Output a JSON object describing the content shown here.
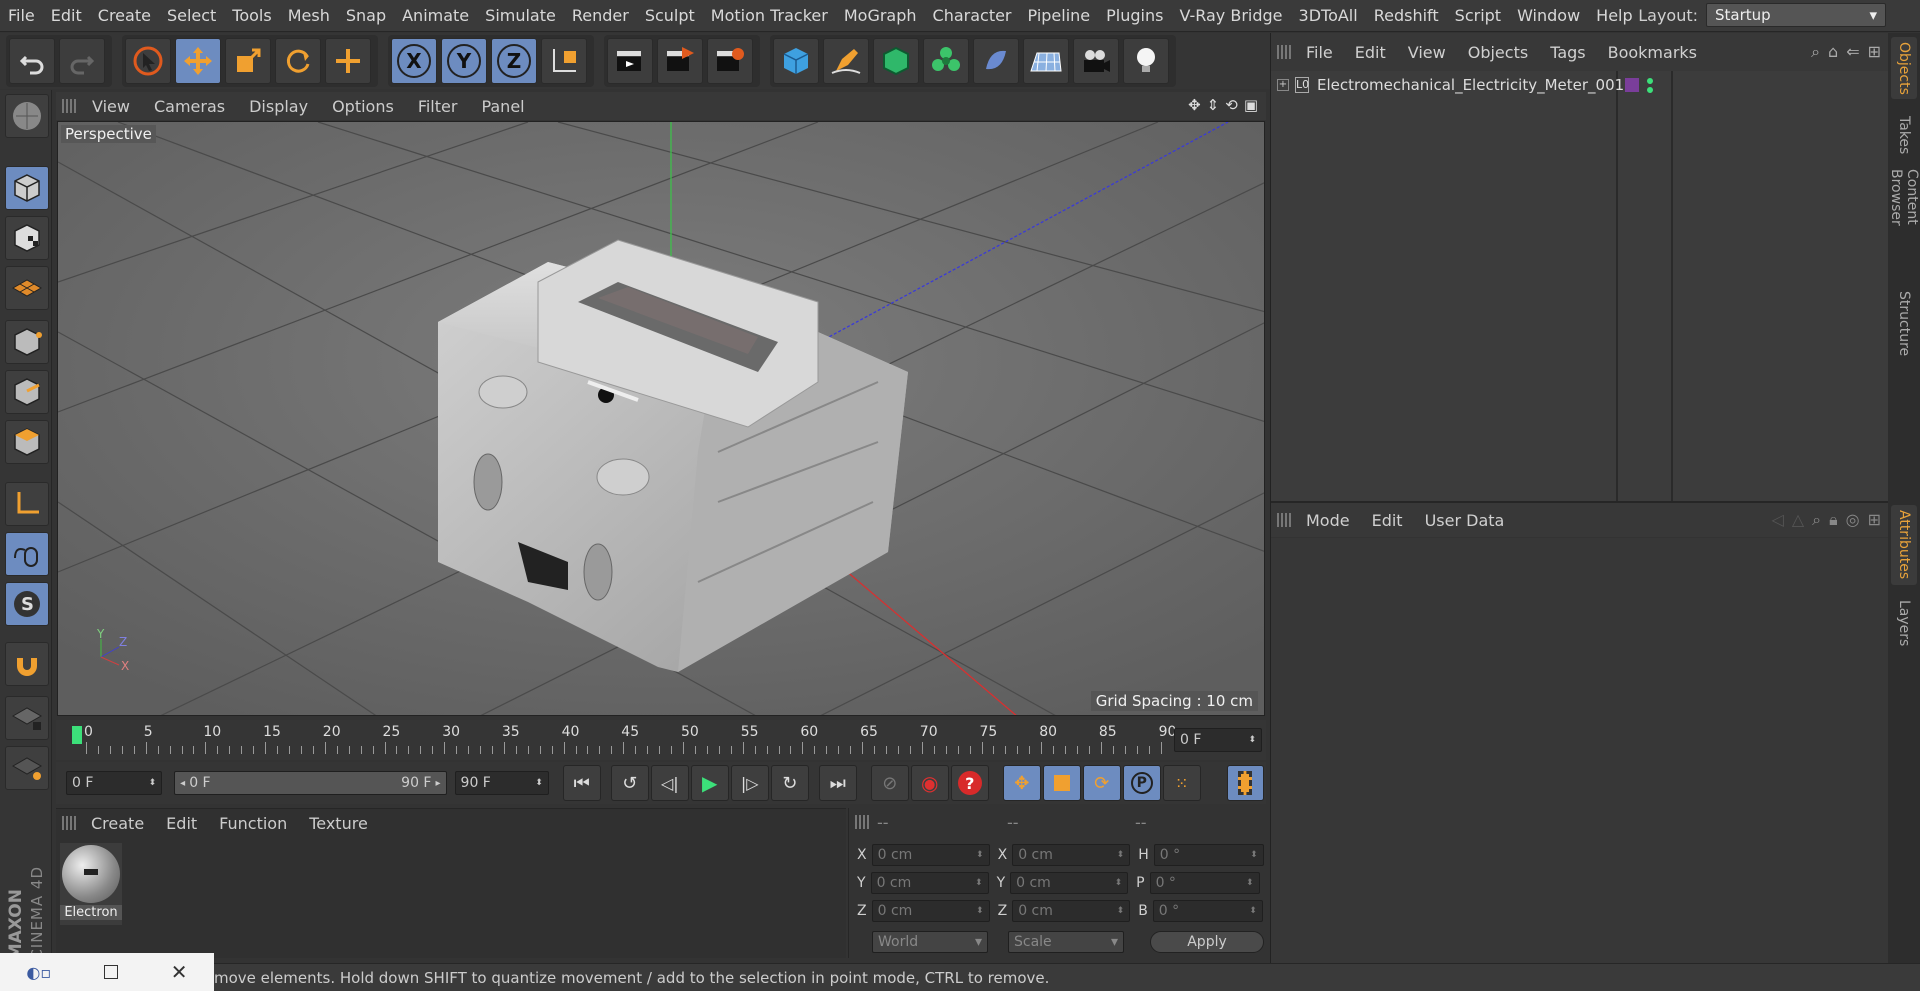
{
  "menu": [
    "File",
    "Edit",
    "Create",
    "Select",
    "Tools",
    "Mesh",
    "Snap",
    "Animate",
    "Simulate",
    "Render",
    "Sculpt",
    "Motion Tracker",
    "MoGraph",
    "Character",
    "Pipeline",
    "Plugins",
    "V-Ray Bridge",
    "3DToAll",
    "Redshift",
    "Script",
    "Window",
    "Help"
  ],
  "layout": {
    "label": "Layout:",
    "value": "Startup"
  },
  "toolbar": {
    "axis_x": "X",
    "axis_y": "Y",
    "axis_z": "Z"
  },
  "viewport": {
    "menu": [
      "View",
      "Cameras",
      "Display",
      "Options",
      "Filter",
      "Panel"
    ],
    "label": "Perspective",
    "grid_spacing": "Grid Spacing : 10 cm",
    "axis_y": "Y",
    "axis_z": "Z",
    "axis_x": "X"
  },
  "timeline": {
    "ticks": [
      "0",
      "5",
      "10",
      "15",
      "20",
      "25",
      "30",
      "35",
      "40",
      "45",
      "50",
      "55",
      "60",
      "65",
      "70",
      "75",
      "80",
      "85",
      "90"
    ],
    "current_frame": "0 F"
  },
  "transport": {
    "start": "0 F",
    "range_start": "0 F",
    "range_end": "90 F",
    "end": "90 F"
  },
  "material": {
    "menu": [
      "Create",
      "Edit",
      "Function",
      "Texture"
    ],
    "item_name": "Electron"
  },
  "coords": {
    "headers": [
      "--",
      "--",
      "--"
    ],
    "rows": [
      {
        "a": "X",
        "av": "0 cm",
        "b": "X",
        "bv": "0 cm",
        "c": "H",
        "cv": "0 °"
      },
      {
        "a": "Y",
        "av": "0 cm",
        "b": "Y",
        "bv": "0 cm",
        "c": "P",
        "cv": "0 °"
      },
      {
        "a": "Z",
        "av": "0 cm",
        "b": "Z",
        "bv": "0 cm",
        "c": "B",
        "cv": "0 °"
      }
    ],
    "space": "World",
    "mode": "Scale",
    "apply": "Apply"
  },
  "objects": {
    "menu": [
      "File",
      "Edit",
      "View",
      "Objects",
      "Tags",
      "Bookmarks"
    ],
    "item": "Electromechanical_Electricity_Meter_001",
    "layer_color": "#7a3e9a"
  },
  "attributes": {
    "menu": [
      "Mode",
      "Edit",
      "User Data"
    ]
  },
  "side_tabs": [
    "Objects",
    "Takes",
    "Content Browser",
    "Structure",
    "Attributes",
    "Layers"
  ],
  "status": "move elements. Hold down SHIFT to quantize movement / add to the selection in point mode, CTRL to remove.",
  "brand": {
    "line1": "MAXON",
    "line2": "CINEMA 4D"
  },
  "colors": {
    "accent": "#6d8cc0",
    "orange": "#e8a23a",
    "playhead": "#3ce07a"
  }
}
